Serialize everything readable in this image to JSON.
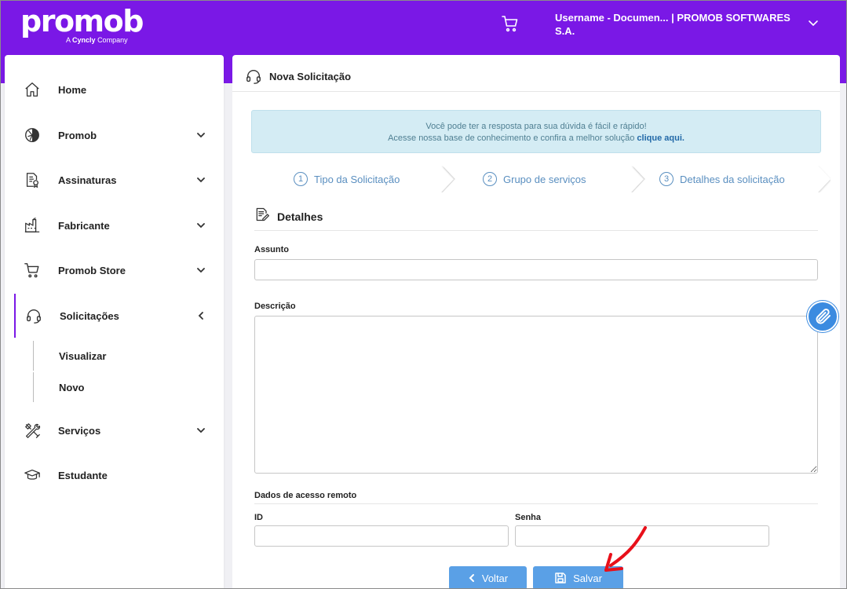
{
  "header": {
    "logo": "promob",
    "logo_sub_prefix": "A",
    "logo_sub_brand": "Cyncly",
    "logo_sub_suffix": "Company",
    "user": "Username - Documen... | PROMOB SOFTWARES S.A.",
    "cart_icon": "cart-icon",
    "user_menu_icon": "chevron-down-icon"
  },
  "sidebar": {
    "items": [
      {
        "label": "Home",
        "icon": "home-icon"
      },
      {
        "label": "Promob",
        "icon": "promob-icon"
      },
      {
        "label": "Assinaturas",
        "icon": "subscription-icon"
      },
      {
        "label": "Fabricante",
        "icon": "factory-icon"
      },
      {
        "label": "Promob Store",
        "icon": "cart-icon"
      },
      {
        "label": "Solicitações",
        "icon": "headset-icon"
      },
      {
        "label": "Serviços",
        "icon": "tools-icon"
      },
      {
        "label": "Estudante",
        "icon": "graduation-cap-icon"
      }
    ],
    "subitems": [
      "Visualizar",
      "Novo"
    ]
  },
  "main": {
    "title": "Nova Solicitação",
    "info_line1": "Você pode ter a resposta para sua dúvida é fácil e rápido!",
    "info_line2_prefix": "Acesse nossa base de conhecimento e confira a melhor solução",
    "info_link": "clique aqui.",
    "steps": [
      {
        "num": "1",
        "label": "Tipo da Solicitação"
      },
      {
        "num": "2",
        "label": "Grupo de serviços"
      },
      {
        "num": "3",
        "label": "Detalhes da solicitação"
      }
    ],
    "section_title": "Detalhes",
    "assunto_label": "Assunto",
    "assunto_value": "",
    "descricao_label": "Descrição",
    "descricao_value": "",
    "remote_title": "Dados de acesso remoto",
    "id_label": "ID",
    "id_value": "",
    "senha_label": "Senha",
    "senha_value": "",
    "back_label": "Voltar",
    "save_label": "Salvar"
  },
  "colors": {
    "brand": "#7a18e6",
    "button": "#5aa0e6",
    "info_bg": "#d4ecf4",
    "step_text": "#5a8fc0",
    "arrow": "#e8101a"
  }
}
